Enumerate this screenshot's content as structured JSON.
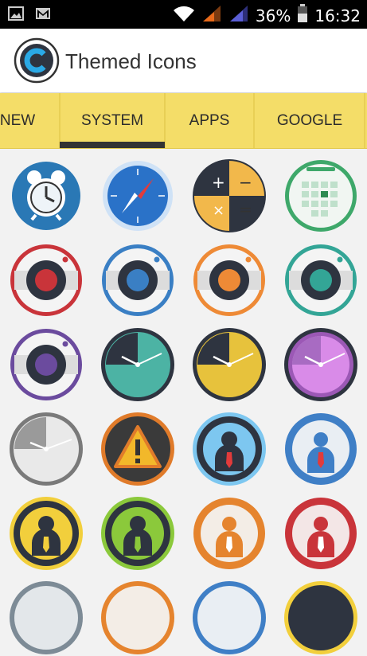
{
  "status_bar": {
    "battery_percent": "36%",
    "time": "16:32",
    "icons": [
      "image-icon",
      "mail-icon",
      "wifi-icon",
      "signal-icon-1",
      "signal-icon-2",
      "battery-icon"
    ]
  },
  "app": {
    "title": "Themed Icons"
  },
  "tabs": [
    {
      "label": "NEW"
    },
    {
      "label": "SYSTEM"
    },
    {
      "label": "APPS"
    },
    {
      "label": "GOOGLE"
    }
  ],
  "selected_tab": "SYSTEM",
  "icons": [
    {
      "name": "alarm-clock-icon"
    },
    {
      "name": "compass-browser-icon"
    },
    {
      "name": "calculator-icon"
    },
    {
      "name": "calendar-icon"
    },
    {
      "name": "camera-red-icon"
    },
    {
      "name": "camera-blue-icon"
    },
    {
      "name": "camera-orange-icon"
    },
    {
      "name": "camera-teal-icon"
    },
    {
      "name": "camera-purple-icon"
    },
    {
      "name": "clock-teal-icon"
    },
    {
      "name": "clock-yellow-icon"
    },
    {
      "name": "clock-purple-icon"
    },
    {
      "name": "clock-gray-icon"
    },
    {
      "name": "warning-icon"
    },
    {
      "name": "contact-lightblue-icon"
    },
    {
      "name": "contact-blue-icon"
    },
    {
      "name": "contact-yellow-icon"
    },
    {
      "name": "contact-green-icon"
    },
    {
      "name": "contact-orange-icon"
    },
    {
      "name": "contact-red-icon"
    }
  ],
  "colors": {
    "tab_bar": "#f4dd68",
    "indicator": "#333333",
    "status_bar": "#000000",
    "signal_orange": "#e86a1a",
    "signal_purple": "#5b5fd6"
  }
}
